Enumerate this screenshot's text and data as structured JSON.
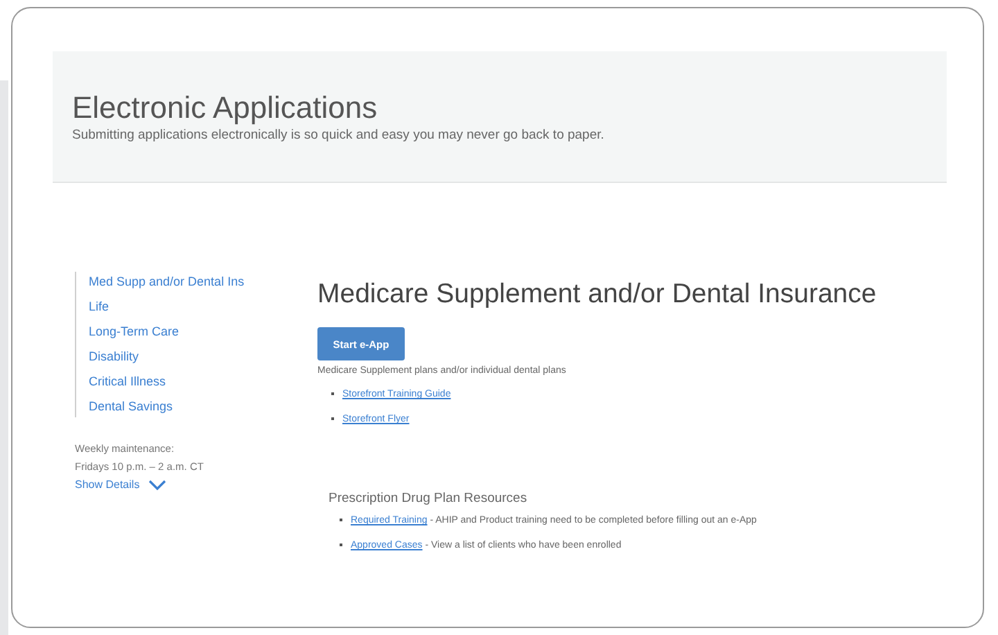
{
  "header": {
    "title": "Electronic Applications",
    "subtitle": "Submitting applications electronically is so quick and easy you may never go back to paper."
  },
  "sidebar": {
    "items": [
      {
        "label": "Med Supp and/or Dental Ins"
      },
      {
        "label": "Life"
      },
      {
        "label": "Long-Term Care"
      },
      {
        "label": "Disability"
      },
      {
        "label": "Critical Illness"
      },
      {
        "label": "Dental Savings"
      }
    ],
    "maintenance": [
      "Weekly maintenance:",
      "Fridays 10 p.m. – 2 a.m. CT"
    ],
    "show_details": "Show Details"
  },
  "main": {
    "title": "Medicare Supplement and/or Dental Insurance",
    "button": "Start e-App",
    "description": "Medicare Supplement plans and/or individual dental plans",
    "links": [
      {
        "label": "Storefront Training Guide"
      },
      {
        "label": "Storefront Flyer"
      }
    ]
  },
  "resources": {
    "title": "Prescription Drug Plan Resources",
    "items": [
      {
        "link": "Required Training",
        "text": " - AHIP and Product training need to be completed before filling out an e-App"
      },
      {
        "link": "Approved Cases",
        "text": " - View a list of clients who have been enrolled"
      }
    ]
  }
}
